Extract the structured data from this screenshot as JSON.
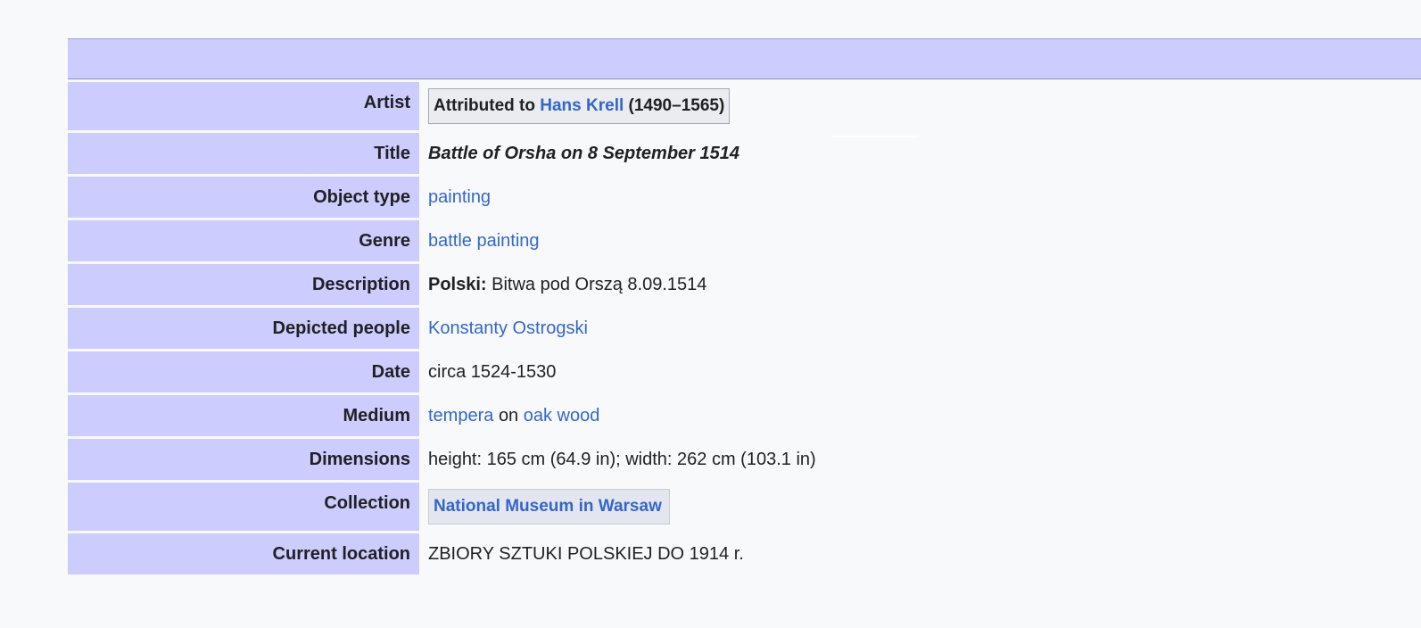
{
  "fields": {
    "artist": {
      "label": "Artist",
      "prefix": "Attributed to",
      "name": "Hans Krell",
      "years": "(1490–1565)"
    },
    "title": {
      "label": "Title",
      "value": "Battle of Orsha on 8 September 1514"
    },
    "object_type": {
      "label": "Object type",
      "value": "painting"
    },
    "genre": {
      "label": "Genre",
      "value": "battle painting"
    },
    "description": {
      "label": "Description",
      "lang": "Polski:",
      "value": "Bitwa pod Orszą 8.09.1514"
    },
    "depicted_people": {
      "label": "Depicted people",
      "value": "Konstanty Ostrogski"
    },
    "date": {
      "label": "Date",
      "value": "circa 1524-1530"
    },
    "medium": {
      "label": "Medium",
      "material": "tempera",
      "connector": "on",
      "support": "oak wood"
    },
    "dimensions": {
      "label": "Dimensions",
      "value": "height: 165 cm (64.9 in); width: 262 cm (103.1 in)"
    },
    "collection": {
      "label": "Collection",
      "value": "National Museum in Warsaw"
    },
    "current_location": {
      "label": "Current location",
      "value": "ZBIORY SZTUKI POLSKIEJ DO 1914 r."
    }
  },
  "colors": {
    "label_bg": "#ccccff",
    "link": "#3366cc",
    "page_bg": "#f8f9fa"
  }
}
